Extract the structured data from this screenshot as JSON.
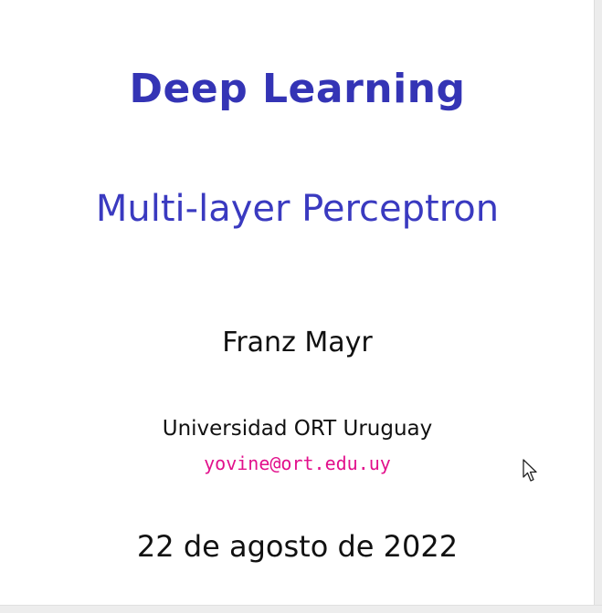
{
  "slide": {
    "title": "Deep Learning",
    "subtitle": "Multi-layer Perceptron",
    "author": "Franz Mayr",
    "institute": "Universidad ORT Uruguay",
    "email": "yovine@ort.edu.uy",
    "date": "22 de agosto de 2022"
  },
  "colors": {
    "title": "#3434b5",
    "email": "#e2108c",
    "text": "#111111"
  },
  "icons": {
    "pointer": "mouse-pointer-icon"
  }
}
